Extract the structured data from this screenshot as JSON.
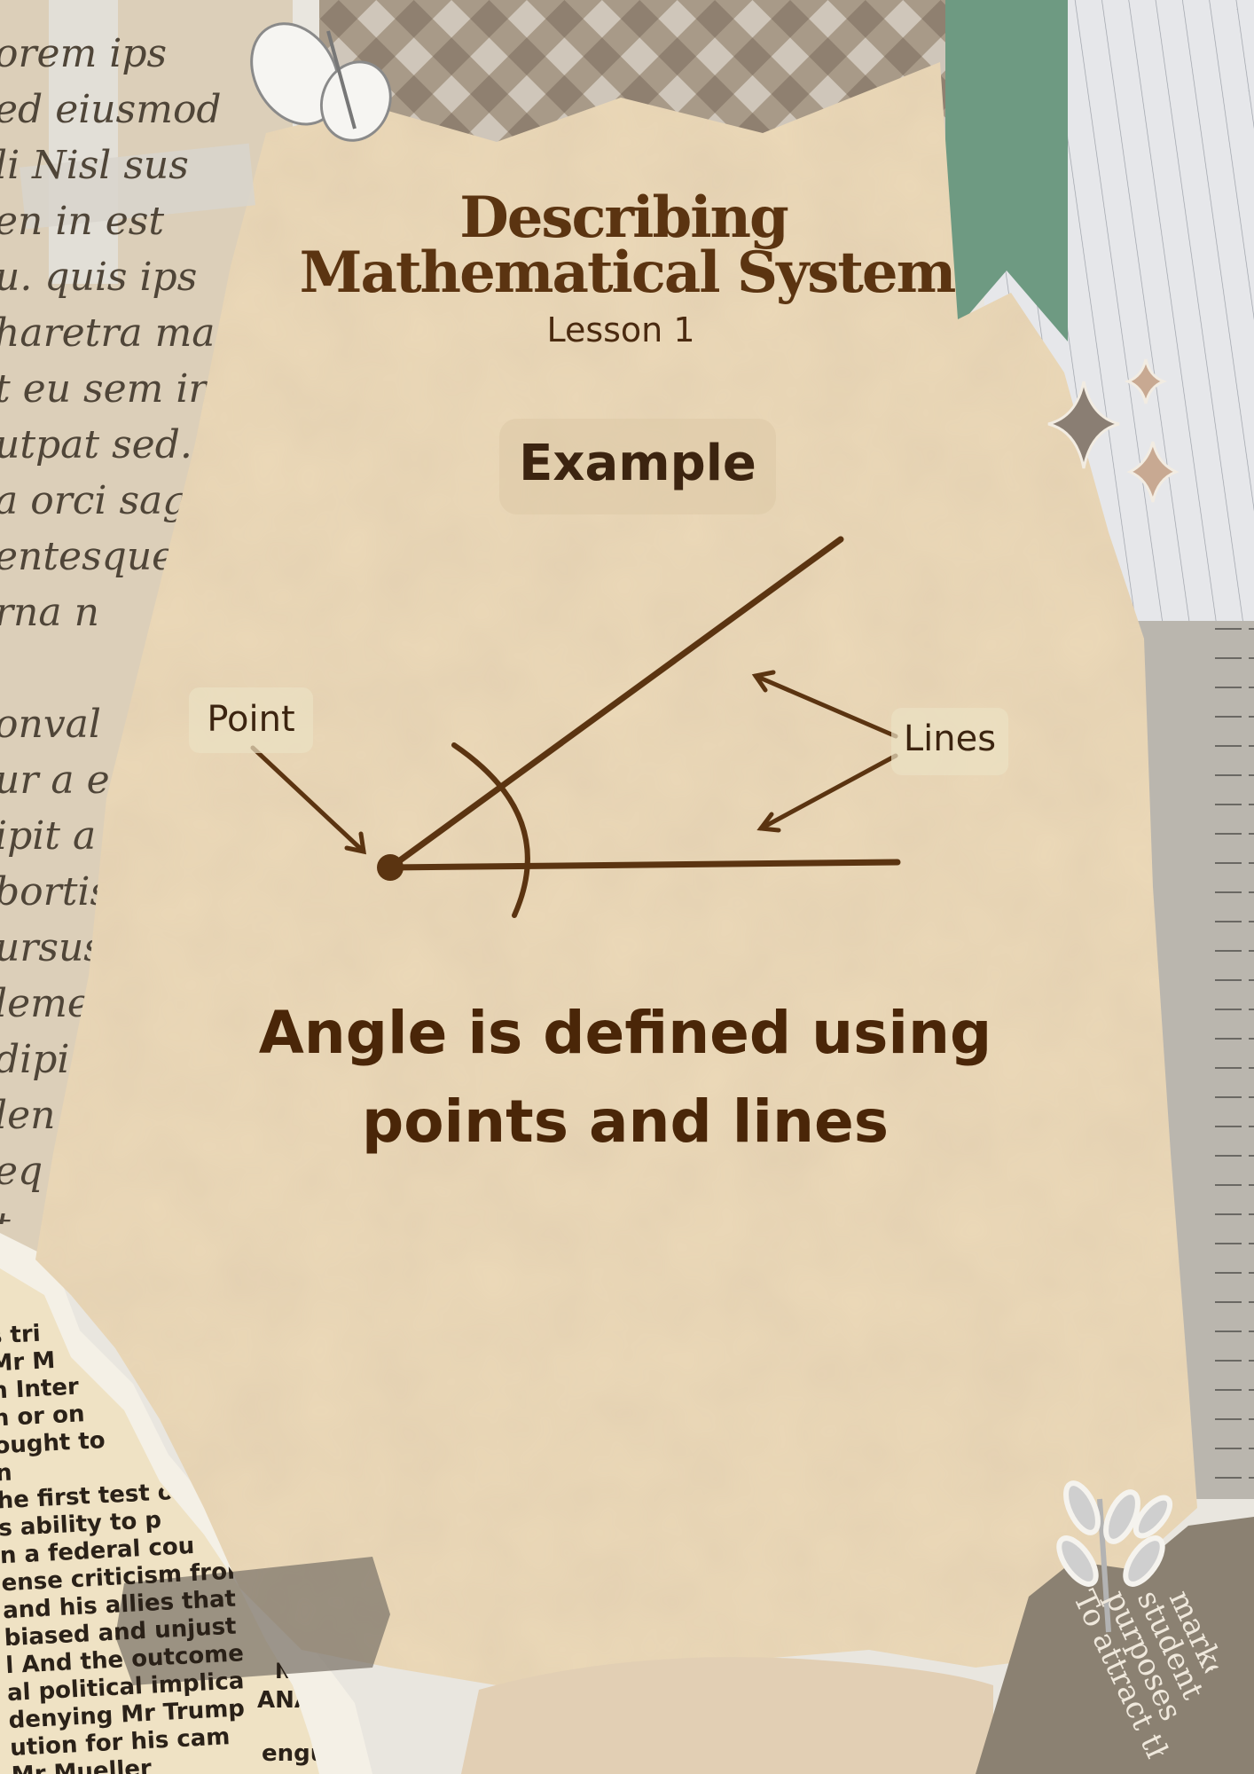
{
  "document": {
    "title_line1": "Describing",
    "title_line2": "Mathematical System",
    "subtitle": "Lesson 1",
    "example_label": "Example",
    "caption": "Angle is defined using points and lines"
  },
  "diagram": {
    "point_label": "Point",
    "lines_label": "Lines"
  },
  "decor": {
    "left_newspaper_lines": [
      "orem ips",
      "ed   eiusmod",
      "li   Nisl sus",
      "en   in est",
      "u.  quis  ips",
      "haretra mas",
      "t eu sem inte",
      "utpat sed. Ris",
      "a orci sagitti",
      "entesque el",
      "rna n",
      "",
      "onval",
      "ur a e",
      "ipit a",
      "bortis",
      "ursus.",
      "lemen",
      "dipi",
      "len",
      "eq",
      "t"
    ],
    "bottom_news_lines": [
      "s tri",
      "Mr M",
      "n Inter",
      "n or on",
      "ought to",
      "n",
      "he first test o",
      "s ability to p",
      "n a federal cou",
      "ense criticism from",
      "and his allies that",
      "biased and unjust",
      "l And the outcome",
      "al political implica",
      "denying Mr Trump",
      "ution for his cam",
      "Mr Mueller"
    ],
    "bottom_news_small": [
      "NE",
      "ANALYS",
      "engulfed his W"
    ],
    "bottom_right_lines": [
      "To attract the",
      "purposes",
      "students and",
      "marketing"
    ],
    "colors": {
      "paper": "#ecd9b8",
      "ink": "#5b3411",
      "green_ribbon": "#6e9a82"
    }
  }
}
